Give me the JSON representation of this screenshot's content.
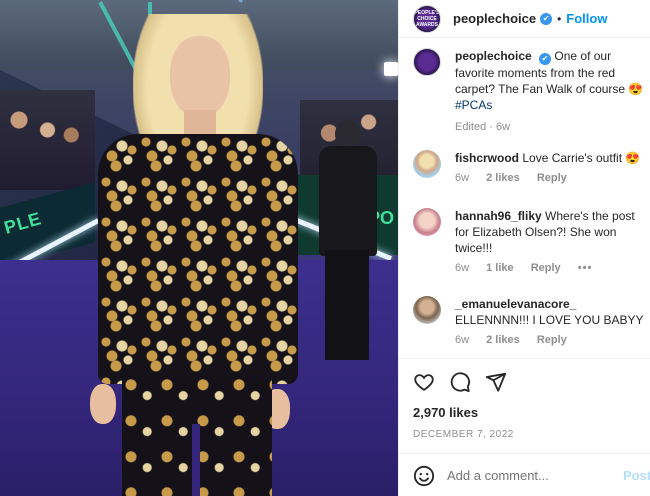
{
  "post": {
    "photo_alt": "Woman in embellished black suit on red carpet",
    "sign_left_text": "PLE",
    "sign_right_text": "PO",
    "brand_avatar_text": "PEOPLE'S CHOICE AWARDS"
  },
  "header": {
    "username": "peoplechoice",
    "verified": "✔",
    "separator": "•",
    "follow_label": "Follow"
  },
  "caption": {
    "username": "peoplechoice",
    "verified": "✔",
    "text": "One of our favorite moments from the red carpet? The Fan Walk of course 😍",
    "hashtag": "#PCAs",
    "edited": "Edited · 6w"
  },
  "comments": [
    {
      "username": "fishcrwood",
      "text": "Love Carrie's outfit 😍",
      "age": "6w",
      "likes": "2 likes",
      "reply": "Reply"
    },
    {
      "username": "hannah96_fliky",
      "text": "Where's the post for Elizabeth Olsen?! She won twice!!!",
      "age": "6w",
      "likes": "1 like",
      "reply": "Reply",
      "more": "•••"
    },
    {
      "username": "_emanuelevanacore_",
      "text": "ELLENNNN!!! I LOVE YOU BABYY",
      "age": "6w",
      "likes": "2 likes",
      "reply": "Reply"
    }
  ],
  "footer": {
    "likes": "2,970 likes",
    "date": "DECEMBER 7, 2022",
    "add_comment_placeholder": "Add a comment...",
    "post_label": "Post"
  }
}
